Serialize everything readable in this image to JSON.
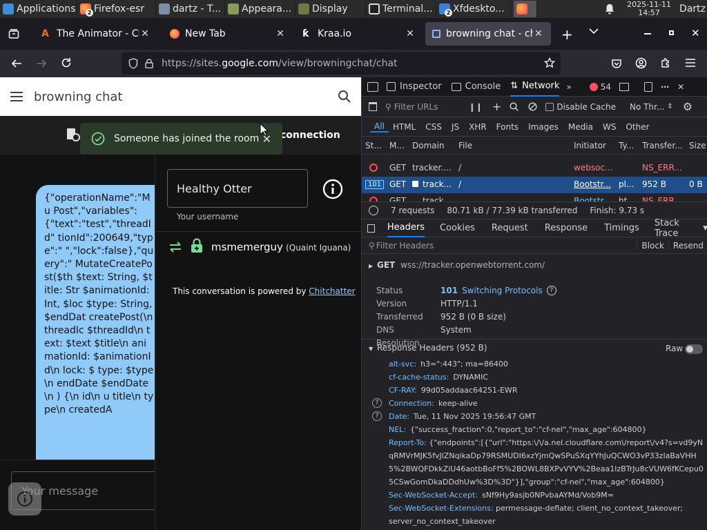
{
  "taskbar": {
    "apps_label": "Applications",
    "items": [
      {
        "label": "Firefox-esr",
        "badge": "2"
      },
      {
        "label": "dartz - T..."
      },
      {
        "label": "Appeara..."
      },
      {
        "label": "Display"
      },
      {
        "label": "Terminal..."
      },
      {
        "label": "Xfdeskto...",
        "badge": "2"
      }
    ],
    "date": "2025-11-11",
    "time": "14:57",
    "user": "Dartz"
  },
  "tabs": [
    {
      "label": "The Animator - Chr"
    },
    {
      "label": "New Tab"
    },
    {
      "label": "Kraa.io"
    },
    {
      "label": "browning chat - cha"
    }
  ],
  "url": {
    "prefix": "https://sites.",
    "domain": "google.com",
    "path": "/view/browningchat/chat"
  },
  "site": {
    "title": "browning chat"
  },
  "toast": {
    "text": "Someone has joined the room",
    "behind_text": "connection"
  },
  "bubble": {
    "text": "{\"operationName\":\"Mu Post\",\"variables\": {\"text\":\"test\",\"threadId\" tionId\":200649,\"type\":\" \",\"lock\":false},\"query\":\" MutateCreatePost($th $text: String, $title: Str $animationId: Int, $loc $type: String, $endDat createPost(\\n threadIc $threadId\\n text: $text $title\\n animationId: $animationId\\n lock: $ type: $type\\n endDate $endDate\\n ) {\\n id\\n u title\\n type\\n createdA"
  },
  "message_placeholder": "Your message",
  "chat_panel": {
    "username_value": "Healthy Otter",
    "username_label": "Your username",
    "user_name": "msmemerguy",
    "user_alias": "(Quaint Iguana)",
    "powered_text": "This conversation is powered by",
    "powered_link": "Chitchatter"
  },
  "devtools": {
    "tabs": [
      "Inspector",
      "Console",
      "Network"
    ],
    "error_count": "54",
    "filter_placeholder": "Filter URLs",
    "disable_cache": "Disable Cache",
    "throttle": "No Thr...",
    "type_filters": [
      "All",
      "HTML",
      "CSS",
      "JS",
      "XHR",
      "Fonts",
      "Images",
      "Media",
      "WS",
      "Other"
    ],
    "columns": [
      "St...",
      "M...",
      "Domain",
      "File",
      "Initiator",
      "Ty...",
      "Transfer...",
      "Size"
    ],
    "requests": [
      {
        "status": "",
        "method": "GET",
        "domain": "tracker....",
        "file": "/",
        "initiator": "websoc...",
        "type": "",
        "transferred": "NS_ERR...",
        "size": ""
      },
      {
        "status": "101",
        "method": "GET",
        "domain": "track...",
        "file": "/",
        "initiator": "Bootstr...",
        "type": "pl...",
        "transferred": "952 B",
        "size": "0 B"
      },
      {
        "status": "",
        "method": "GET",
        "domain": "track...",
        "file": "/",
        "initiator": "Bootstr...",
        "type": "ht...",
        "transferred": "NS_ERR...",
        "size": ""
      }
    ],
    "summary": {
      "requests": "7 requests",
      "transferred": "80.71 kB / 77.39 kB transferred",
      "finish": "Finish: 9.73 s"
    },
    "detail_tabs": [
      "Headers",
      "Cookies",
      "Request",
      "Response",
      "Timings",
      "Stack Trace"
    ],
    "filter_headers": "Filter Headers",
    "block": "Block",
    "resend": "Resend",
    "request_line": {
      "method": "GET",
      "url": "wss://tracker.openwebtorrent.com/"
    },
    "general": [
      {
        "k": "Status",
        "v_code": "101",
        "v": "Switching Protocols"
      },
      {
        "k": "Version",
        "v": "HTTP/1.1"
      },
      {
        "k": "Transferred",
        "v": "952 B (0 B size)"
      },
      {
        "k": "DNS Resolution",
        "v": "System"
      }
    ],
    "response_headers_title": "Response Headers (952 B)",
    "raw_label": "Raw",
    "headers": [
      {
        "k": "alt-svc:",
        "v": "h3=\":443\"; ma=86400"
      },
      {
        "k": "cf-cache-status:",
        "v": "DYNAMIC"
      },
      {
        "k": "CF-RAY:",
        "v": "99d05addaac64251-EWR"
      },
      {
        "k": "Connection:",
        "v": "keep-alive",
        "help": true
      },
      {
        "k": "Date:",
        "v": "Tue, 11 Nov 2025 19:56:47 GMT",
        "help": true
      },
      {
        "k": "NEL:",
        "v": "{\"success_fraction\":0,\"report_to\":\"cf-nel\",\"max_age\":604800}"
      },
      {
        "k": "Report-To:",
        "v": "{\"endpoints\":[{\"url\":\"https:\\/\\/a.nel.cloudflare.com\\/report\\/v4?s=vd9yNqRMVrMJK5fvJlZNqikaDp79RSMUDI6xzYjmQwSPuSXqYYhJuQCWO3vP33zlaBaVHH5%2BWQFDkkZiU46aotbBoFf5%2BOWL8BXPvVYV%2Beaa1lzBTrJu8cVUW6fKCepu05CSwGomDkaDDdhUw%3D%3D\"}],\"group\":\"cf-nel\",\"max_age\":604800}"
      },
      {
        "k": "Sec-WebSocket-Accept:",
        "v": "sNf9Hy9asjb0NPvbaAYMd/Vob9M="
      },
      {
        "k": "Sec-WebSocket-Extensions:",
        "v": "permessage-deflate; client_no_context_takeover; server_no_context_takeover"
      }
    ]
  }
}
